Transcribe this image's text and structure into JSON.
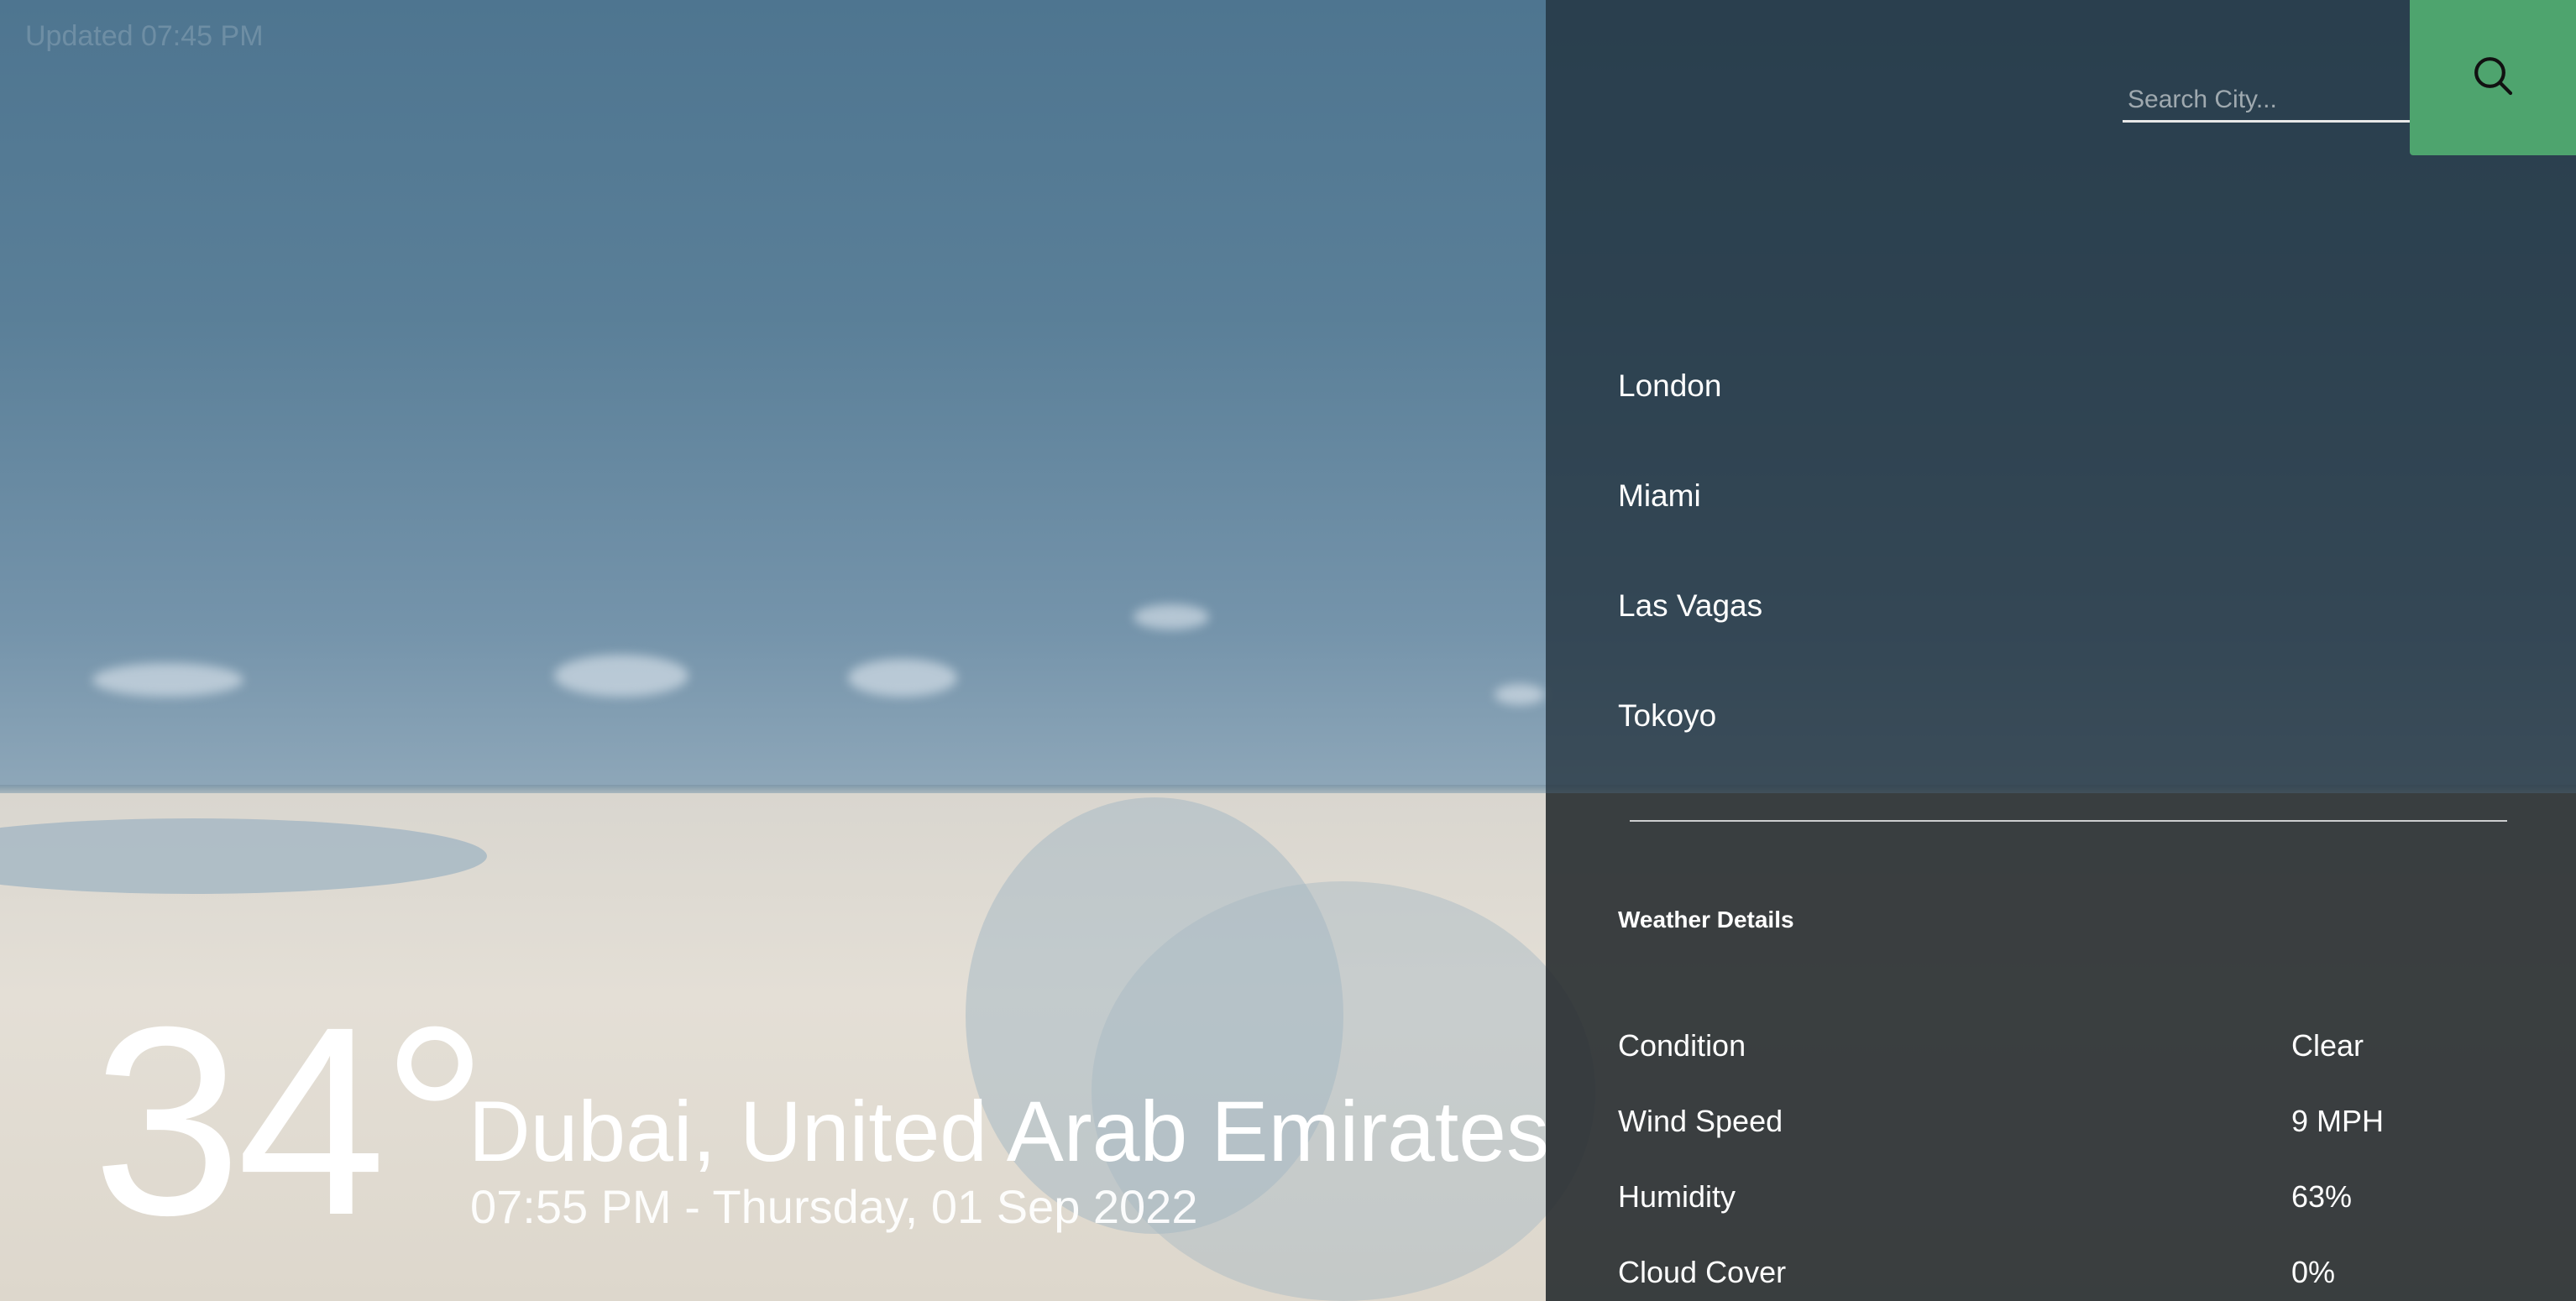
{
  "updated": "Updated 07:45 PM",
  "current": {
    "temperature": "34°",
    "location": "Dubai, United Arab Emirates",
    "datetime": "07:55 PM - Thursday, 01 Sep 2022"
  },
  "search": {
    "placeholder": "Search City...",
    "icon": "search-icon"
  },
  "cities": [
    "London",
    "Miami",
    "Las Vagas",
    "Tokoyo"
  ],
  "details": {
    "title": "Weather Details",
    "rows": [
      {
        "label": "Condition",
        "value": "Clear"
      },
      {
        "label": "Wind Speed",
        "value": "9 MPH"
      },
      {
        "label": "Humidity",
        "value": "63%"
      },
      {
        "label": "Cloud Cover",
        "value": "0%"
      }
    ]
  },
  "colors": {
    "accent": "#4ea46e",
    "panel": "#1e2c37"
  }
}
